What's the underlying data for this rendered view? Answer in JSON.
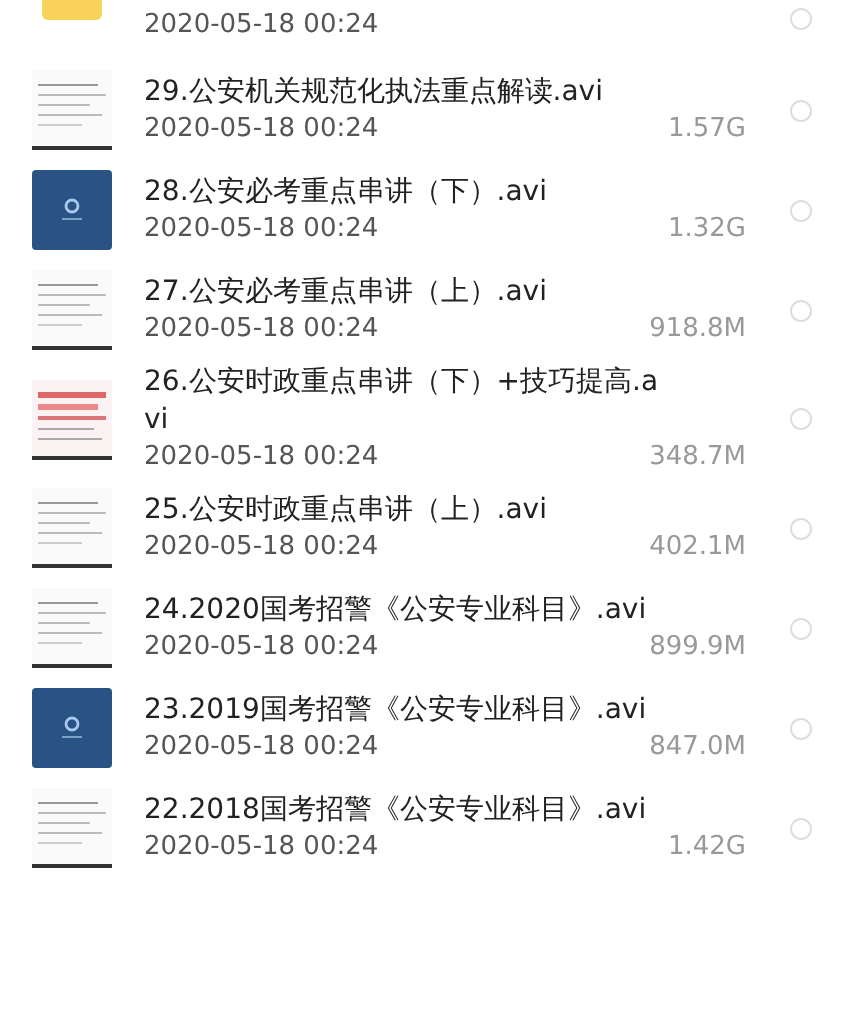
{
  "files": [
    {
      "kind": "folder",
      "date": "2020-05-18 00:24",
      "selected": false
    },
    {
      "kind": "doc",
      "title": "29.公安机关规范化执法重点解读.avi",
      "date": "2020-05-18 00:24",
      "size": "1.57G",
      "selected": false
    },
    {
      "kind": "video",
      "title": "28.公安必考重点串讲（下）.avi",
      "date": "2020-05-18 00:24",
      "size": "1.32G",
      "selected": false
    },
    {
      "kind": "doc",
      "title": "27.公安必考重点串讲（上）.avi",
      "date": "2020-05-18 00:24",
      "size": "918.8M",
      "selected": false
    },
    {
      "kind": "reddoc",
      "title": "26.公安时政重点串讲（下）+技巧提高.avi",
      "date": "2020-05-18 00:24",
      "size": "348.7M",
      "selected": false
    },
    {
      "kind": "doc",
      "title": "25.公安时政重点串讲（上）.avi",
      "date": "2020-05-18 00:24",
      "size": "402.1M",
      "selected": false
    },
    {
      "kind": "doc",
      "title": "24.2020国考招警《公安专业科目》.avi",
      "date": "2020-05-18 00:24",
      "size": "899.9M",
      "selected": false
    },
    {
      "kind": "video",
      "title": "23.2019国考招警《公安专业科目》.avi",
      "date": "2020-05-18 00:24",
      "size": "847.0M",
      "selected": false
    },
    {
      "kind": "doc",
      "title": "22.2018国考招警《公安专业科目》.avi",
      "date": "2020-05-18 00:24",
      "size": "1.42G",
      "selected": false
    }
  ]
}
